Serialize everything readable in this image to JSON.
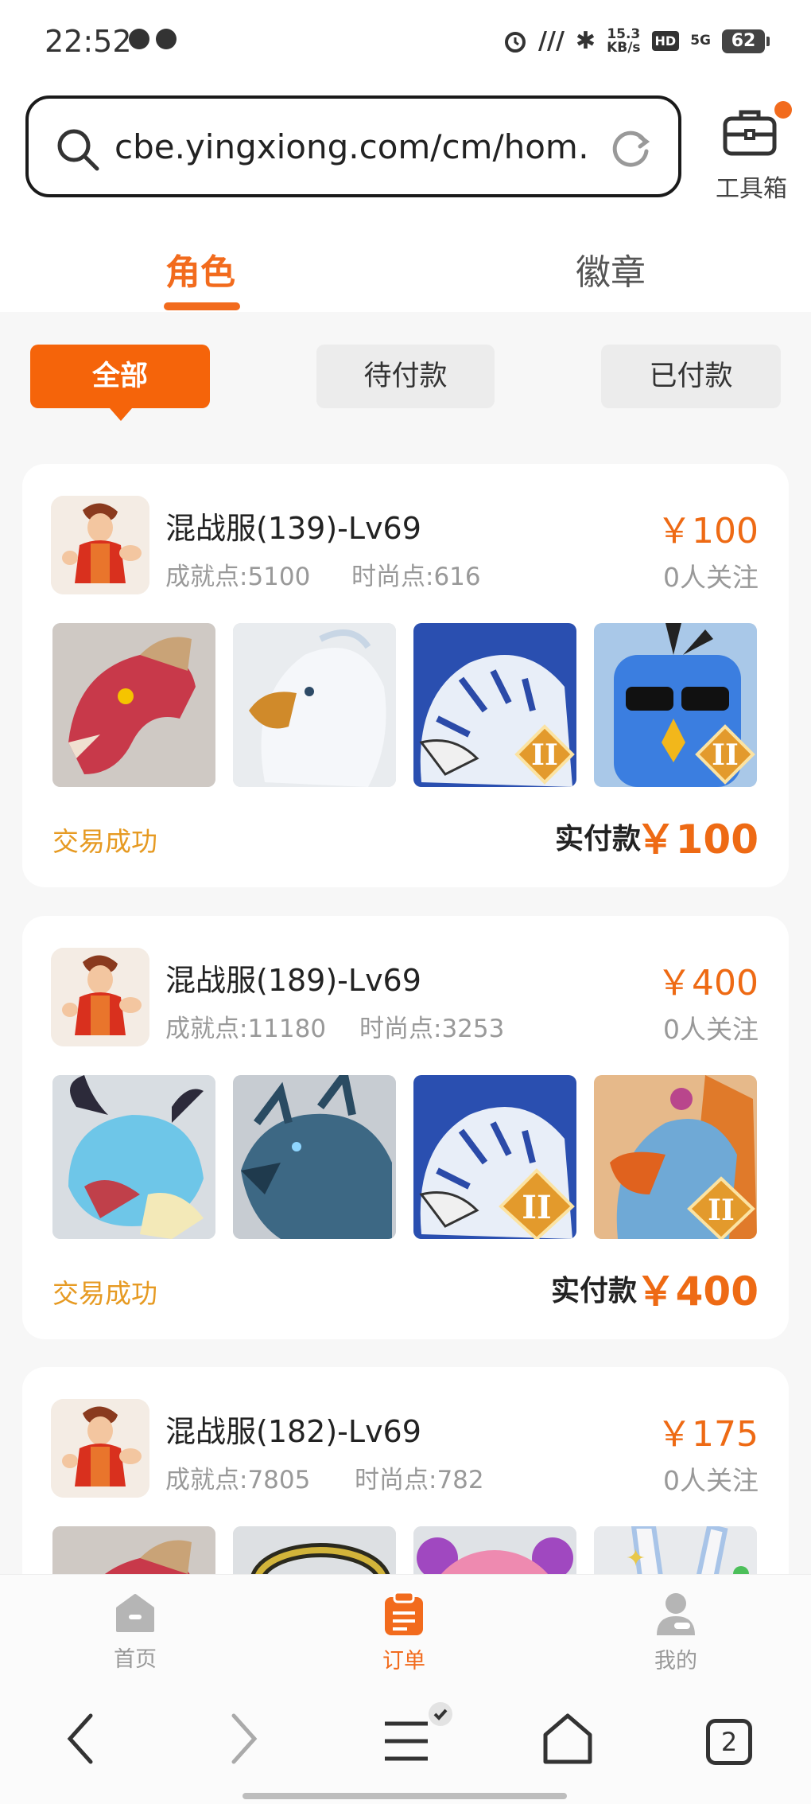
{
  "status_bar": {
    "time": "22:52",
    "net_speed_value": "15.3",
    "net_speed_unit": "KB/s",
    "hd": "HD",
    "network": "5G",
    "battery": "62"
  },
  "browser": {
    "url": "cbe.yingxiong.com/cm/hom…",
    "toolbox_label": "工具箱",
    "tab_count": "2"
  },
  "tabs": [
    {
      "label": "角色",
      "active": true
    },
    {
      "label": "徽章",
      "active": false
    }
  ],
  "filters": [
    {
      "label": "全部",
      "active": true
    },
    {
      "label": "待付款",
      "active": false
    },
    {
      "label": "已付款",
      "active": false
    }
  ],
  "orders": [
    {
      "title": "混战服(139)-Lv69",
      "achievement": "成就点:5100",
      "fashion": "时尚点:616",
      "price": "￥100",
      "followers": "0人关注",
      "status": "交易成功",
      "paid_label": "实付款",
      "paid_amount": "￥100",
      "pets": [
        "red-dragon",
        "white-griffin",
        "blue-tiger-ii",
        "blue-bird-ii"
      ]
    },
    {
      "title": "混战服(189)-Lv69",
      "achievement": "成就点:11180",
      "fashion": "时尚点:3253",
      "price": "￥400",
      "followers": "0人关注",
      "status": "交易成功",
      "paid_label": "实付款",
      "paid_amount": "￥400",
      "pets": [
        "cyan-dragon",
        "dark-blue-dragon",
        "blue-tiger-ii",
        "phoenix-ii"
      ]
    },
    {
      "title": "混战服(182)-Lv69",
      "achievement": "成就点:7805",
      "fashion": "时尚点:782",
      "price": "￥175",
      "followers": "0人关注",
      "pets": [
        "red-dragon",
        "gold-ring",
        "pink-bear",
        "white-rabbit"
      ]
    }
  ],
  "bottom_nav": [
    {
      "label": "首页",
      "icon": "home-icon",
      "active": false
    },
    {
      "label": "订单",
      "icon": "clipboard-icon",
      "active": true
    },
    {
      "label": "我的",
      "icon": "user-icon",
      "active": false
    }
  ],
  "colors": {
    "accent": "#f26b1d",
    "status_success": "#e69a22",
    "filter_active_bg": "#f5640a"
  }
}
